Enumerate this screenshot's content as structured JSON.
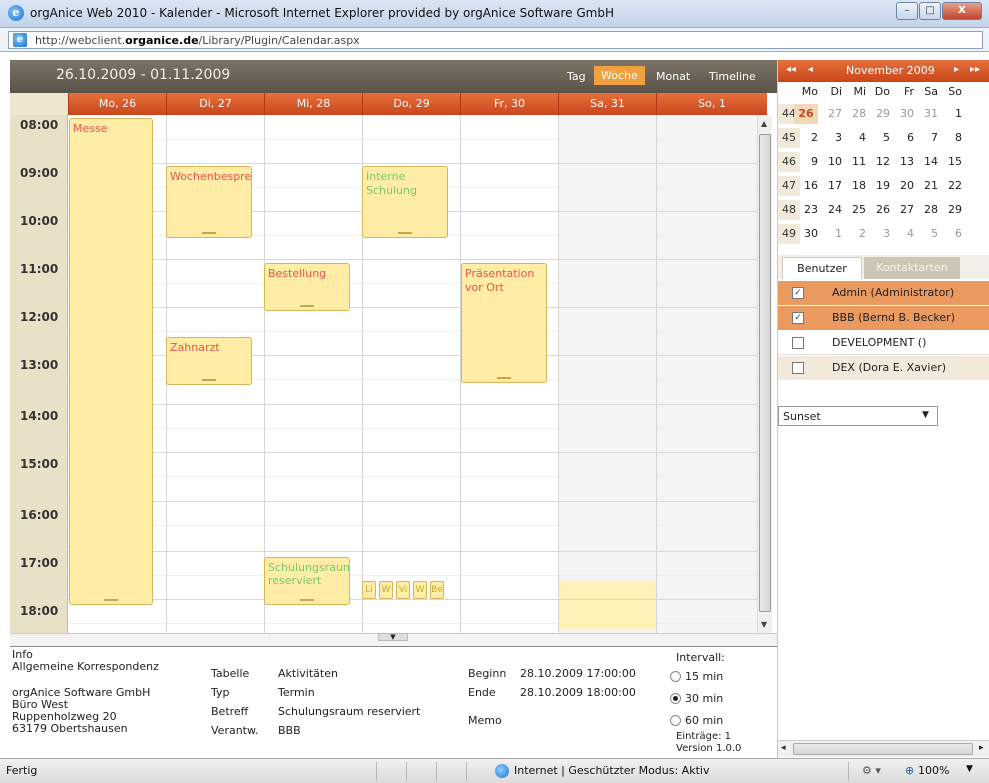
{
  "window": {
    "title": "orgAnice Web 2010 - Kalender - Microsoft Internet Explorer provided by orgAnice Software GmbH",
    "url_prefix": "http://webclient.",
    "url_domain": "organice.de",
    "url_path": "/Library/Plugin/Calendar.aspx",
    "min_label": "–",
    "max_label": "□",
    "close_label": "X"
  },
  "calendar": {
    "range": "26.10.2009 - 01.11.2009",
    "views": [
      "Tag",
      "Woche",
      "Monat",
      "Timeline"
    ],
    "active_view": "Woche",
    "days": [
      "Mo, 26",
      "Di, 27",
      "Mi, 28",
      "Do, 29",
      "Fr, 30",
      "Sa, 31",
      "So, 1"
    ],
    "hours": [
      "08:00",
      "09:00",
      "10:00",
      "11:00",
      "12:00",
      "13:00",
      "14:00",
      "15:00",
      "16:00",
      "17:00",
      "18:00"
    ],
    "appointments": [
      {
        "title": "Messe",
        "color": "red"
      },
      {
        "title": "Wochenbespred",
        "color": "red"
      },
      {
        "title": "Interne Schulung",
        "color": "green"
      },
      {
        "title": "Bestellung",
        "color": "red"
      },
      {
        "title": "Präsentation vor Ort",
        "color": "red"
      },
      {
        "title": "Zahnarzt",
        "color": "red"
      },
      {
        "title": "Schulungsraum reserviert",
        "color": "green"
      }
    ],
    "small_appts": [
      "Li",
      "W",
      "Vi",
      "W",
      "Be"
    ]
  },
  "info": {
    "header": "Info",
    "company_line": "Allgemeine Korrespondenz",
    "address": [
      "orgAnice Software GmbH",
      "Büro West",
      "Ruppenholzweg 20",
      "63179 Obertshausen"
    ],
    "fields": [
      {
        "label": "Tabelle",
        "value": "Aktivitäten"
      },
      {
        "label": "Typ",
        "value": "Termin"
      },
      {
        "label": "Betreff",
        "value": "Schulungsraum reserviert"
      },
      {
        "label": "Verantw.",
        "value": "BBB"
      }
    ],
    "begin_label": "Beginn",
    "begin_value": "28.10.2009 17:00:00",
    "end_label": "Ende",
    "end_value": "28.10.2009 18:00:00",
    "memo_label": "Memo",
    "interval_label": "Intervall:",
    "intervals": [
      "15 min",
      "30 min",
      "60 min"
    ],
    "selected_interval": "30 min",
    "entries": "Einträge: 1",
    "version": "Version 1.0.0"
  },
  "minical": {
    "nav_first": "◂◂",
    "nav_prev": "◂",
    "nav_next": "▸",
    "nav_last": "▸▸",
    "month": "November 2009",
    "weekdays": [
      "Mo",
      "Di",
      "Mi",
      "Do",
      "Fr",
      "Sa",
      "So"
    ],
    "weeks": [
      {
        "kw": "44",
        "days": [
          "26",
          "27",
          "28",
          "29",
          "30",
          "31",
          "1"
        ]
      },
      {
        "kw": "45",
        "days": [
          "2",
          "3",
          "4",
          "5",
          "6",
          "7",
          "8"
        ]
      },
      {
        "kw": "46",
        "days": [
          "9",
          "10",
          "11",
          "12",
          "13",
          "14",
          "15"
        ]
      },
      {
        "kw": "47",
        "days": [
          "16",
          "17",
          "18",
          "19",
          "20",
          "21",
          "22"
        ]
      },
      {
        "kw": "48",
        "days": [
          "23",
          "24",
          "25",
          "26",
          "27",
          "28",
          "29"
        ]
      },
      {
        "kw": "49",
        "days": [
          "30",
          "1",
          "2",
          "3",
          "4",
          "5",
          "6"
        ]
      }
    ],
    "today": "26"
  },
  "users": {
    "tabs": [
      "Benutzer",
      "Kontaktarten"
    ],
    "list": [
      {
        "name": "Admin (Administrator)",
        "checked": true
      },
      {
        "name": "BBB (Bernd B. Becker)",
        "checked": true
      },
      {
        "name": "DEVELOPMENT ()",
        "checked": false
      },
      {
        "name": "DEX (Dora E. Xavier)",
        "checked": false
      }
    ],
    "theme": "Sunset"
  },
  "status": {
    "left": "Fertig",
    "zone": "Internet | Geschützter Modus: Aktiv",
    "zoom": "100%"
  }
}
